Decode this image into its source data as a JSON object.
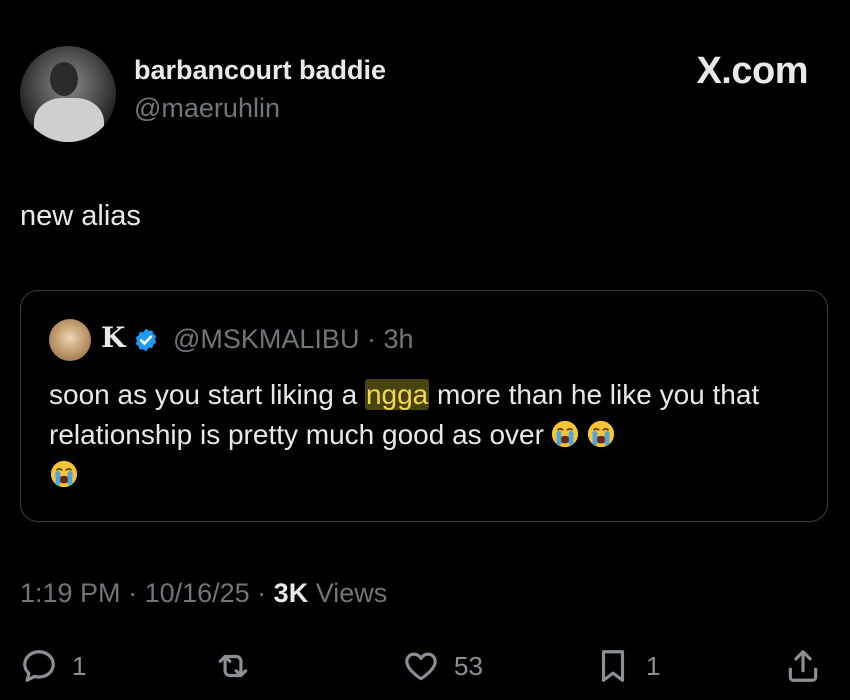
{
  "header": {
    "display_name": "barbancourt baddie",
    "handle": "@maeruhlin",
    "brand": "X.com"
  },
  "tweet": {
    "text": "new alias"
  },
  "quote": {
    "name": "K",
    "handle": "@MSKMALIBU",
    "time": "3h",
    "text_before": "soon as you start liking a ",
    "text_highlight": "ngga",
    "text_after": " more than he like you that relationship is pretty much good as over",
    "emoji": "😭"
  },
  "meta": {
    "time": "1:19 PM",
    "date": "10/16/25",
    "views_count": "3K",
    "views_label": "Views"
  },
  "actions": {
    "replies": "1",
    "reposts": "",
    "likes": "53",
    "bookmarks": "1"
  },
  "colors": {
    "background": "#000000",
    "text_primary": "#e7e9ea",
    "text_secondary": "#71767b",
    "verified": "#1d9bf0",
    "highlight": "#f2d94a"
  }
}
